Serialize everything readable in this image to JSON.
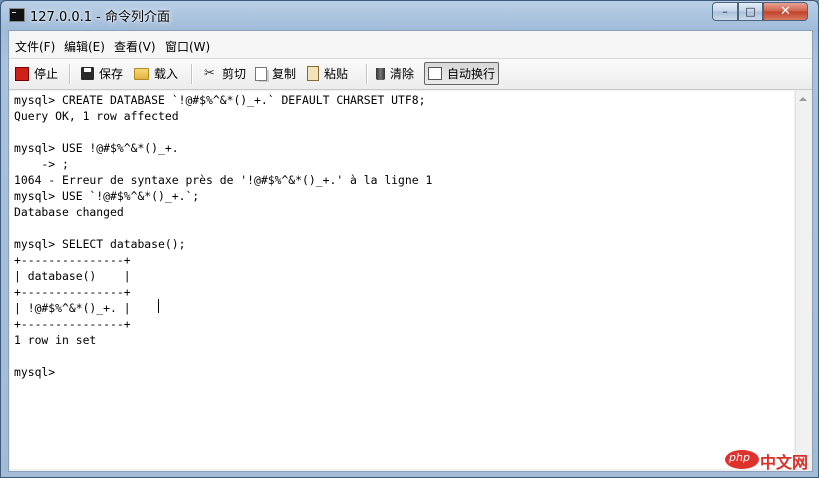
{
  "window": {
    "title": "127.0.0.1 - 命令列介面"
  },
  "window_controls": {
    "minimize": "–",
    "maximize": "□",
    "close": "✕"
  },
  "menu": [
    "文件(F)",
    "编辑(E)",
    "查看(V)",
    "窗口(W)"
  ],
  "toolbar": {
    "stop": "停止",
    "save": "保存",
    "load": "载入",
    "cut": "剪切",
    "copy": "复制",
    "paste": "粘贴",
    "clear": "清除",
    "wrap": "自动换行"
  },
  "console": [
    "mysql> CREATE DATABASE `!@#$%^&*()_+.` DEFAULT CHARSET UTF8;",
    "Query OK, 1 row affected",
    "",
    "mysql> USE !@#$%^&*()_+.",
    "    -> ;",
    "1064 - Erreur de syntaxe près de '!@#$%^&*()_+.' à la ligne 1",
    "mysql> USE `!@#$%^&*()_+.`;",
    "Database changed",
    "",
    "mysql> SELECT database();",
    "+---------------+",
    "| database()    |",
    "+---------------+",
    "| !@#$%^&*()_+. |",
    "+---------------+",
    "1 row in set",
    "",
    "mysql>"
  ],
  "watermark": {
    "badge": "php",
    "text": "中文网"
  }
}
